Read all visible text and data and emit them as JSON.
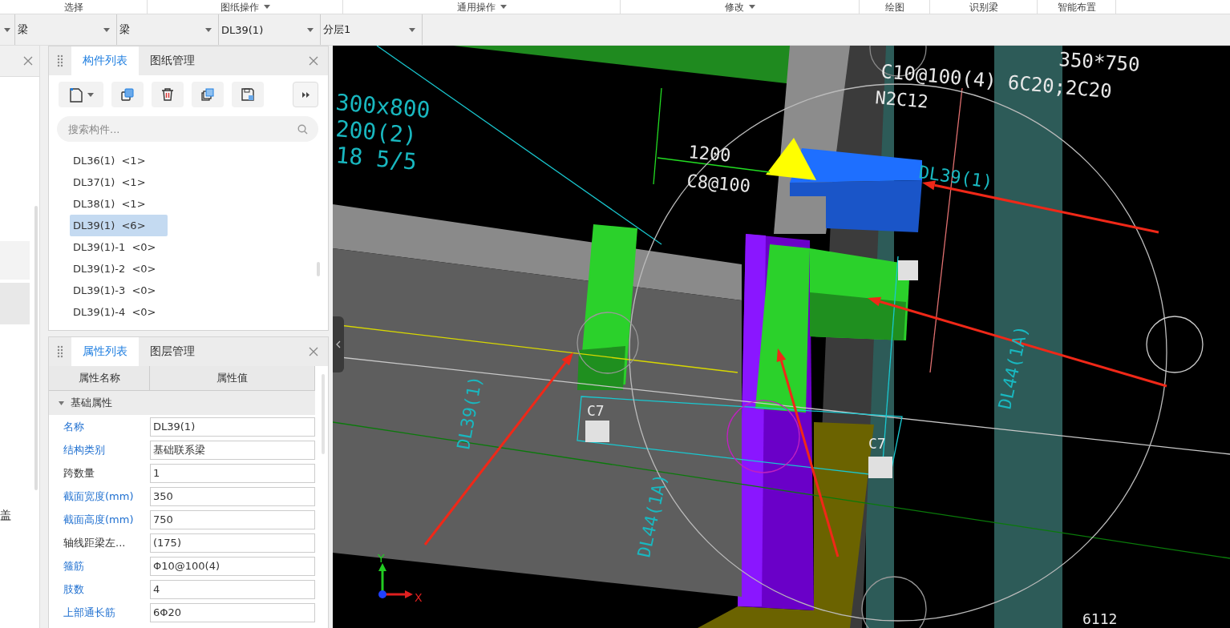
{
  "ribbon": {
    "groups": [
      {
        "label": "选择",
        "dropdown": false
      },
      {
        "label": "图纸操作",
        "dropdown": true
      },
      {
        "label": "通用操作",
        "dropdown": true
      },
      {
        "label": "修改",
        "dropdown": true
      },
      {
        "label": "绘图",
        "dropdown": false
      },
      {
        "label": "识别梁",
        "dropdown": false
      },
      {
        "label": "智能布置",
        "dropdown": false
      }
    ]
  },
  "selectors": [
    {
      "value": "梁"
    },
    {
      "value": "梁"
    },
    {
      "value": "DL39(1)"
    },
    {
      "value": "分层1"
    }
  ],
  "side_strip": {
    "text": "盖"
  },
  "component_panel": {
    "tabs": [
      {
        "label": "构件列表",
        "selected": true
      },
      {
        "label": "图纸管理",
        "selected": false
      }
    ],
    "search": {
      "placeholder": "搜索构件..."
    },
    "items": [
      {
        "label": "DL36(1)  <1>",
        "selected": false
      },
      {
        "label": "DL37(1)  <1>",
        "selected": false
      },
      {
        "label": "DL38(1)  <1>",
        "selected": false
      },
      {
        "label": "DL39(1)  <6>",
        "selected": true
      },
      {
        "label": "DL39(1)-1  <0>",
        "selected": false
      },
      {
        "label": "DL39(1)-2  <0>",
        "selected": false
      },
      {
        "label": "DL39(1)-3  <0>",
        "selected": false
      },
      {
        "label": "DL39(1)-4  <0>",
        "selected": false
      }
    ]
  },
  "property_panel": {
    "tabs": [
      {
        "label": "属性列表",
        "selected": true
      },
      {
        "label": "图层管理",
        "selected": false
      }
    ],
    "columns": [
      "属性名称",
      "属性值"
    ],
    "group": {
      "label": "基础属性",
      "expanded": true
    },
    "rows": [
      {
        "name": "名称",
        "value": "DL39(1)",
        "emphasized": true
      },
      {
        "name": "结构类别",
        "value": "基础联系梁",
        "emphasized": true
      },
      {
        "name": "跨数量",
        "value": "1",
        "emphasized": false
      },
      {
        "name": "截面宽度(mm)",
        "value": "350",
        "emphasized": true
      },
      {
        "name": "截面高度(mm)",
        "value": "750",
        "emphasized": true
      },
      {
        "name": "轴线距梁左...",
        "value": "(175)",
        "emphasized": false
      },
      {
        "name": "箍筋",
        "value": "Φ10@100(4)",
        "emphasized": true
      },
      {
        "name": "肢数",
        "value": "4",
        "emphasized": true
      },
      {
        "name": "上部通长筋",
        "value": "6Φ20",
        "emphasized": true
      }
    ]
  },
  "canvas": {
    "labels": [
      {
        "text": "300x800",
        "kind": "annotation"
      },
      {
        "text": "200(2)",
        "kind": "annotation"
      },
      {
        "text": "18 5/5",
        "kind": "annotation"
      },
      {
        "text": "1200",
        "kind": "dimension"
      },
      {
        "text": "C8@100",
        "kind": "dimension"
      },
      {
        "text": "350*750",
        "kind": "dimension"
      },
      {
        "text": "C10@100(4) 6C20;2C20",
        "kind": "dimension"
      },
      {
        "text": "N2C12",
        "kind": "dimension"
      },
      {
        "text": "DL39(1)",
        "kind": "annotation"
      },
      {
        "text": "DL39(1)",
        "kind": "annotation"
      },
      {
        "text": "DL44(1A)",
        "kind": "annotation"
      },
      {
        "text": "DL44(1A)",
        "kind": "annotation"
      },
      {
        "text": "C7",
        "kind": "dimension"
      },
      {
        "text": "C7",
        "kind": "dimension"
      },
      {
        "text": "6112",
        "kind": "dimension"
      }
    ],
    "axes": {
      "x": "X",
      "y": "Y"
    }
  }
}
